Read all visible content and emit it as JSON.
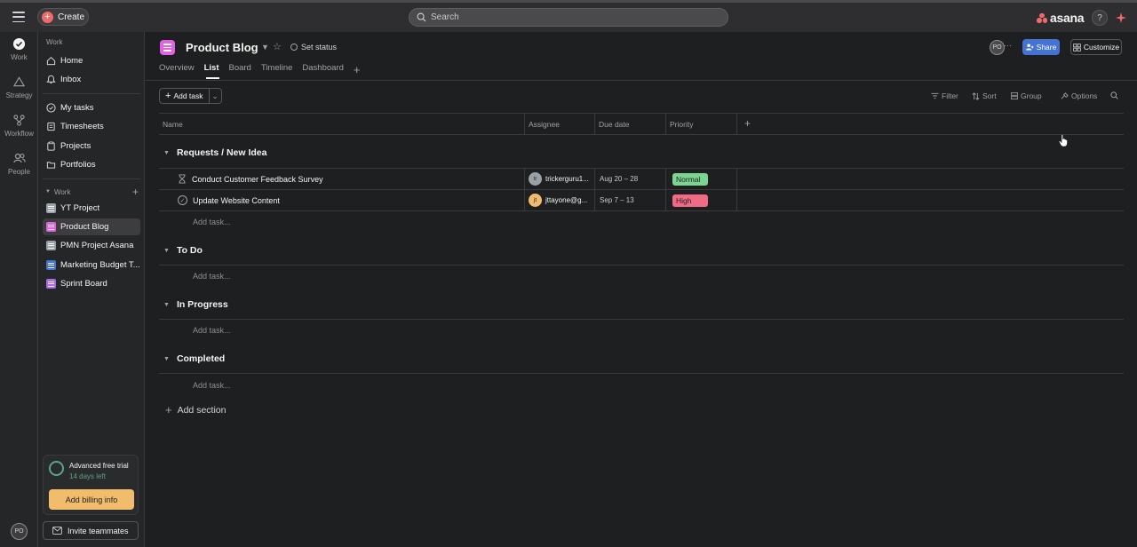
{
  "topbar": {
    "create_label": "Create",
    "search_placeholder": "Search",
    "logo_text": "asana",
    "help_label": "?"
  },
  "rail": {
    "items": [
      {
        "label": "Work",
        "icon": "check-circle-icon"
      },
      {
        "label": "Strategy",
        "icon": "triangle-icon"
      },
      {
        "label": "Workflow",
        "icon": "workflow-icon"
      },
      {
        "label": "People",
        "icon": "people-icon"
      }
    ],
    "avatar": "PO"
  },
  "sidebar": {
    "section_label": "Work",
    "nav": [
      {
        "label": "Home",
        "icon": "home-icon"
      },
      {
        "label": "Inbox",
        "icon": "inbox-icon"
      }
    ],
    "nav2": [
      {
        "label": "My tasks",
        "icon": "check-circle-icon"
      },
      {
        "label": "Timesheets",
        "icon": "timesheet-icon"
      },
      {
        "label": "Projects",
        "icon": "clipboard-icon"
      },
      {
        "label": "Portfolios",
        "icon": "folder-icon"
      }
    ],
    "work_header": "Work",
    "projects": [
      {
        "label": "YT Project",
        "color": "#9aa2a8"
      },
      {
        "label": "Product Blog",
        "color": "#e362e3"
      },
      {
        "label": "PMN Project Asana",
        "color": "#9aa2a8"
      },
      {
        "label": "Marketing Budget T...",
        "color": "#4573d2"
      },
      {
        "label": "Sprint Board",
        "color": "#a96be8"
      }
    ],
    "trial": {
      "title": "Advanced free trial",
      "subtitle": "14 days left",
      "billing_label": "Add billing info"
    },
    "invite_label": "Invite teammates"
  },
  "header": {
    "project_title": "Product Blog",
    "set_status": "Set status",
    "tabs": [
      "Overview",
      "List",
      "Board",
      "Timeline",
      "Dashboard"
    ],
    "active_tab": "List",
    "avatar": "PO",
    "share_label": "Share",
    "customize_label": "Customize"
  },
  "toolbar": {
    "add_task": "Add task",
    "filter": "Filter",
    "sort": "Sort",
    "group": "Group",
    "options": "Options"
  },
  "table": {
    "columns": [
      "Name",
      "Assignee",
      "Due date",
      "Priority"
    ],
    "sections": [
      {
        "name": "Requests / New Idea",
        "tasks": [
          {
            "name": "Conduct Customer Feedback Survey",
            "assignee": "trickerguru1...",
            "assignee_initials": "tr",
            "assignee_color": "#9aa2a8",
            "due": "Aug 20 – 28",
            "priority": "Normal",
            "priority_color": "#5da283",
            "priority_bg": "#7bd48f",
            "status_icon": "hourglass-icon"
          },
          {
            "name": "Update Website Content",
            "assignee": "jttayone@g...",
            "assignee_initials": "jt",
            "assignee_color": "#f1bd6c",
            "due": "Sep 7 – 13",
            "priority": "High",
            "priority_color": "#e8384f",
            "priority_bg": "#f26b84",
            "status_icon": "check-circle-icon"
          }
        ]
      },
      {
        "name": "To Do",
        "tasks": []
      },
      {
        "name": "In Progress",
        "tasks": []
      },
      {
        "name": "Completed",
        "tasks": []
      }
    ],
    "add_task_label": "Add task...",
    "add_section_label": "Add section"
  }
}
